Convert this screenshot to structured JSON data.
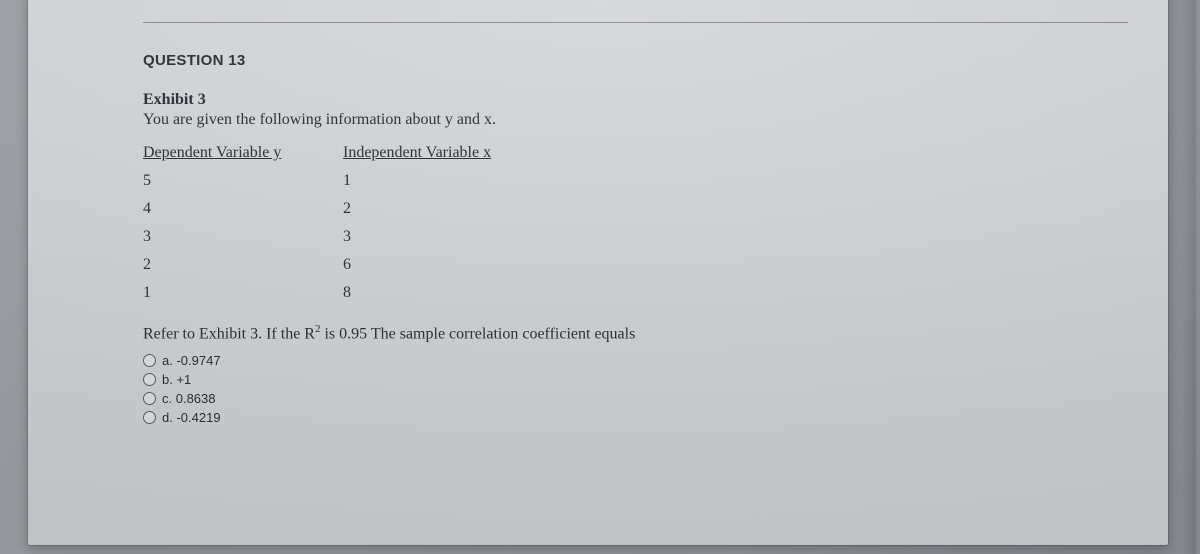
{
  "question_label": "QUESTION 13",
  "exhibit_title": "Exhibit 3",
  "intro_text": "You are given the following information about y and x.",
  "table": {
    "headers": {
      "y": "Dependent Variable y",
      "x": "Independent Variable x"
    },
    "rows": [
      {
        "y": "5",
        "x": "1"
      },
      {
        "y": "4",
        "x": "2"
      },
      {
        "y": "3",
        "x": "3"
      },
      {
        "y": "2",
        "x": "6"
      },
      {
        "y": "1",
        "x": "8"
      }
    ]
  },
  "prompt": {
    "pre": "Refer to Exhibit 3. If the R",
    "sup": "2",
    "post": " is 0.95 The sample correlation coefficient equals"
  },
  "options": [
    {
      "key": "a",
      "text": "a. -0.9747"
    },
    {
      "key": "b",
      "text": "b. +1"
    },
    {
      "key": "c",
      "text": "c. 0.8638"
    },
    {
      "key": "d",
      "text": "d. -0.4219"
    }
  ]
}
